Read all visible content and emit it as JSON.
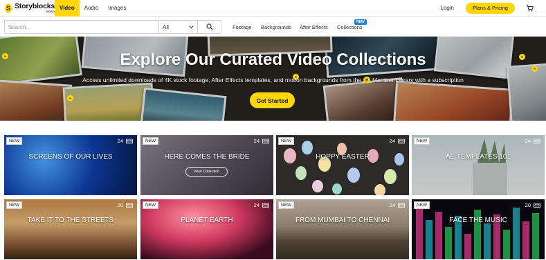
{
  "brand": {
    "name": "Storyblocks",
    "subtitle": "VIDEO",
    "mark": "S"
  },
  "nav": {
    "tabs": [
      {
        "label": "Video",
        "active": true
      },
      {
        "label": "Audio",
        "active": false
      },
      {
        "label": "Images",
        "active": false
      }
    ],
    "login": "Login",
    "pricing": "Plans & Pricing",
    "cart_icon": "cart-icon"
  },
  "search": {
    "placeholder": "Search...",
    "filter_value": "All",
    "search_icon": "search-icon"
  },
  "subnav": {
    "links": [
      "Footage",
      "Backgrounds",
      "After Effects",
      "Collections"
    ],
    "new_badge": "NEW"
  },
  "hero": {
    "title": "Explore Our Curated Video Collections",
    "subtitle_before": "Access unlimited downloads of 4K stock footage, After Effects templates, and motion backgrounds from the",
    "subtitle_after": "Member Library with a subscription",
    "cta": "Get Started",
    "mark": "∞"
  },
  "collections": [
    {
      "title": "SCREENS OF OUR LIVES",
      "count": "24",
      "badge": "NEW"
    },
    {
      "title": "HERE COMES THE BRIDE",
      "count": "24",
      "badge": "NEW",
      "cta": "View Collection"
    },
    {
      "title": "HOPPY EASTER",
      "count": "24",
      "badge": "NEW"
    },
    {
      "title": "AE TEMPLATES 101",
      "count": "24",
      "badge": "NEW"
    },
    {
      "title": "TAKE IT TO THE STREETS",
      "count": "20",
      "badge": "NEW"
    },
    {
      "title": "PLANET EARTH",
      "count": "24",
      "badge": "NEW"
    },
    {
      "title": "FROM MUMBAI TO CHENNAI",
      "count": "24",
      "badge": "NEW"
    },
    {
      "title": "FACE THE MUSIC",
      "count": "20",
      "badge": "NEW"
    }
  ],
  "colors": {
    "accent": "#ffd60a",
    "new_pill": "#1f7ed6"
  }
}
